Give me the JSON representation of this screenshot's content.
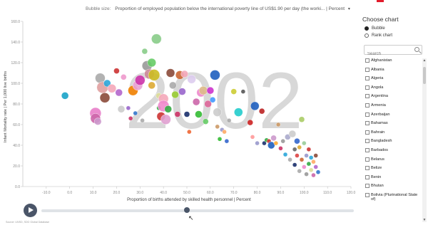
{
  "bubble_size": {
    "label": "Bubble size:",
    "value": "Proportion of employed population below the international poverty line of US$1.90 per day (the worki... | Percent",
    "caret": "▾"
  },
  "chart_data": {
    "type": "scatter",
    "year_watermark": "2002",
    "xlabel": "Proportion of births attended by skilled health personnel | Percent",
    "ylabel": "Infant Mortality rate | Per 1,000 live births",
    "xlim": [
      -20,
      120
    ],
    "ylim": [
      0,
      160
    ],
    "x_ticks": [
      "-10.0",
      "0.0",
      "10.0",
      "20.0",
      "30.0",
      "40.0",
      "50.0",
      "60.0",
      "70.0",
      "80.0",
      "90.0",
      "100.0",
      "110.0",
      "120.0"
    ],
    "y_ticks": [
      "160.0",
      "140.0",
      "120.0",
      "100.0",
      "80.0",
      "60.0",
      "40.0",
      "20.0",
      "0.0"
    ],
    "grid": false,
    "points": [
      {
        "x": -2,
        "y": 88,
        "r": 5,
        "color": "#1aa3c8"
      },
      {
        "x": 11,
        "y": 71,
        "r": 8,
        "color": "#e87ec9"
      },
      {
        "x": 11,
        "y": 66,
        "r": 7,
        "color": "#cc66aa"
      },
      {
        "x": 12,
        "y": 63,
        "r": 5,
        "color": "#cc99cc"
      },
      {
        "x": 13,
        "y": 105,
        "r": 7,
        "color": "#aaaaaa"
      },
      {
        "x": 14,
        "y": 96,
        "r": 8,
        "color": "#e0a0a0"
      },
      {
        "x": 15,
        "y": 86,
        "r": 7,
        "color": "#8b4a3a"
      },
      {
        "x": 16,
        "y": 100,
        "r": 5,
        "color": "#2aa6d9"
      },
      {
        "x": 18,
        "y": 95,
        "r": 6,
        "color": "#f4a7b9"
      },
      {
        "x": 20,
        "y": 112,
        "r": 4,
        "color": "#cc3333"
      },
      {
        "x": 21,
        "y": 91,
        "r": 5,
        "color": "#b366cc"
      },
      {
        "x": 22,
        "y": 75,
        "r": 5,
        "color": "#cccccc"
      },
      {
        "x": 23,
        "y": 106,
        "r": 4,
        "color": "#ee99cc"
      },
      {
        "x": 25,
        "y": 76,
        "r": 3,
        "color": "#9966cc"
      },
      {
        "x": 26,
        "y": 66,
        "r": 3,
        "color": "#cc3366"
      },
      {
        "x": 27,
        "y": 93,
        "r": 7,
        "color": "#f08000"
      },
      {
        "x": 28,
        "y": 71,
        "r": 3,
        "color": "#3377cc"
      },
      {
        "x": 29,
        "y": 98,
        "r": 7,
        "color": "#e9a3d6"
      },
      {
        "x": 30,
        "y": 103,
        "r": 7,
        "color": "#cc33aa"
      },
      {
        "x": 31,
        "y": 64,
        "r": 3,
        "color": "#aaaaaa"
      },
      {
        "x": 32,
        "y": 131,
        "r": 4,
        "color": "#88cc88"
      },
      {
        "x": 33,
        "y": 117,
        "r": 7,
        "color": "#999999"
      },
      {
        "x": 34,
        "y": 109,
        "r": 7,
        "color": "#cc8899"
      },
      {
        "x": 35,
        "y": 98,
        "r": 5,
        "color": "#ddaa33"
      },
      {
        "x": 35,
        "y": 120,
        "r": 6,
        "color": "#66cc66"
      },
      {
        "x": 36,
        "y": 108,
        "r": 8,
        "color": "#ccbb22"
      },
      {
        "x": 37,
        "y": 143,
        "r": 7,
        "color": "#88cc88"
      },
      {
        "x": 38,
        "y": 88,
        "r": 4,
        "color": "#dddd99"
      },
      {
        "x": 38,
        "y": 76,
        "r": 3,
        "color": "#33aa44"
      },
      {
        "x": 39,
        "y": 68,
        "r": 6,
        "color": "#cc3333"
      },
      {
        "x": 40,
        "y": 85,
        "r": 7,
        "color": "#f4a7b9"
      },
      {
        "x": 40,
        "y": 78,
        "r": 8,
        "color": "#ee88cc"
      },
      {
        "x": 41,
        "y": 65,
        "r": 7,
        "color": "#e0a0d0"
      },
      {
        "x": 42,
        "y": 75,
        "r": 5,
        "color": "#33aa44"
      },
      {
        "x": 43,
        "y": 110,
        "r": 6,
        "color": "#8b4a3a"
      },
      {
        "x": 44,
        "y": 98,
        "r": 5,
        "color": "#aaaaaa"
      },
      {
        "x": 45,
        "y": 89,
        "r": 5,
        "color": "#99cc33"
      },
      {
        "x": 46,
        "y": 70,
        "r": 4,
        "color": "#cc3366"
      },
      {
        "x": 47,
        "y": 108,
        "r": 6,
        "color": "#cc6633"
      },
      {
        "x": 48,
        "y": 92,
        "r": 5,
        "color": "#9966cc"
      },
      {
        "x": 49,
        "y": 109,
        "r": 5,
        "color": "#f4a7b9"
      },
      {
        "x": 50,
        "y": 70,
        "r": 4,
        "color": "#1a2f6b"
      },
      {
        "x": 51,
        "y": 53,
        "r": 3,
        "color": "#ee6633"
      },
      {
        "x": 52,
        "y": 104,
        "r": 6,
        "color": "#ddccee"
      },
      {
        "x": 54,
        "y": 82,
        "r": 5,
        "color": "#cc66aa"
      },
      {
        "x": 55,
        "y": 70,
        "r": 5,
        "color": "#33bb33"
      },
      {
        "x": 56,
        "y": 91,
        "r": 6,
        "color": "#ee88cc"
      },
      {
        "x": 57,
        "y": 93,
        "r": 6,
        "color": "#ddbb88"
      },
      {
        "x": 58,
        "y": 63,
        "r": 4,
        "color": "#66cc66"
      },
      {
        "x": 59,
        "y": 80,
        "r": 5,
        "color": "#dd6699"
      },
      {
        "x": 60,
        "y": 93,
        "r": 5,
        "color": "#cc33cc"
      },
      {
        "x": 61,
        "y": 84,
        "r": 4,
        "color": "#4499ff"
      },
      {
        "x": 62,
        "y": 108,
        "r": 7,
        "color": "#1f5fbf"
      },
      {
        "x": 63,
        "y": 72,
        "r": 6,
        "color": "#cccccc"
      },
      {
        "x": 63,
        "y": 58,
        "r": 3,
        "color": "#cc9966"
      },
      {
        "x": 64,
        "y": 46,
        "r": 3,
        "color": "#33bb33"
      },
      {
        "x": 65,
        "y": 55,
        "r": 3,
        "color": "#9999cc"
      },
      {
        "x": 66,
        "y": 53,
        "r": 3,
        "color": "#ffaa66"
      },
      {
        "x": 67,
        "y": 44,
        "r": 3,
        "color": "#3366cc"
      },
      {
        "x": 68,
        "y": 64,
        "r": 3,
        "color": "#aaaaaa"
      },
      {
        "x": 70,
        "y": 92,
        "r": 4,
        "color": "#cccc33"
      },
      {
        "x": 72,
        "y": 72,
        "r": 6,
        "color": "#22cccc"
      },
      {
        "x": 74,
        "y": 92,
        "r": 3,
        "color": "#555555"
      },
      {
        "x": 77,
        "y": 62,
        "r": 4,
        "color": "#cc2222"
      },
      {
        "x": 78,
        "y": 48,
        "r": 3,
        "color": "#ff9999"
      },
      {
        "x": 79,
        "y": 78,
        "r": 6,
        "color": "#1f5fbf"
      },
      {
        "x": 80,
        "y": 42,
        "r": 3,
        "color": "#9999cc"
      },
      {
        "x": 82,
        "y": 73,
        "r": 4,
        "color": "#bb2222"
      },
      {
        "x": 83,
        "y": 42,
        "r": 3,
        "color": "#1a2f6b"
      },
      {
        "x": 84,
        "y": 45,
        "r": 3,
        "color": "#33aa44"
      },
      {
        "x": 85,
        "y": 44,
        "r": 3,
        "color": "#cc3333"
      },
      {
        "x": 86,
        "y": 40,
        "r": 5,
        "color": "#1f5fbf"
      },
      {
        "x": 87,
        "y": 47,
        "r": 4,
        "color": "#cc99cc"
      },
      {
        "x": 88,
        "y": 42,
        "r": 3,
        "color": "#ffaa33"
      },
      {
        "x": 89,
        "y": 60,
        "r": 3,
        "color": "#cc9966"
      },
      {
        "x": 90,
        "y": 37,
        "r": 3,
        "color": "#cc3366"
      },
      {
        "x": 91,
        "y": 44,
        "r": 3,
        "color": "#999999"
      },
      {
        "x": 92,
        "y": 31,
        "r": 3,
        "color": "#2aa6d9"
      },
      {
        "x": 93,
        "y": 48,
        "r": 4,
        "color": "#aaaacc"
      },
      {
        "x": 94,
        "y": 26,
        "r": 3,
        "color": "#aaaaaa"
      },
      {
        "x": 95,
        "y": 51,
        "r": 5,
        "color": "#cccccc"
      },
      {
        "x": 96,
        "y": 36,
        "r": 3,
        "color": "#666666"
      },
      {
        "x": 96,
        "y": 21,
        "r": 3,
        "color": "#1a2f6b"
      },
      {
        "x": 97,
        "y": 44,
        "r": 4,
        "color": "#3366cc"
      },
      {
        "x": 97,
        "y": 30,
        "r": 3,
        "color": "#dd4444"
      },
      {
        "x": 98,
        "y": 38,
        "r": 3,
        "color": "#ddaa33"
      },
      {
        "x": 98,
        "y": 15,
        "r": 3,
        "color": "#aaaaaa"
      },
      {
        "x": 99,
        "y": 65,
        "r": 4,
        "color": "#aacc66"
      },
      {
        "x": 99,
        "y": 26,
        "r": 3,
        "color": "#cc6633"
      },
      {
        "x": 100,
        "y": 42,
        "r": 3,
        "color": "#99cc99"
      },
      {
        "x": 100,
        "y": 19,
        "r": 3,
        "color": "#ee88cc"
      },
      {
        "x": 101,
        "y": 30,
        "r": 3,
        "color": "#9999cc"
      },
      {
        "x": 101,
        "y": 12,
        "r": 3,
        "color": "#999999"
      },
      {
        "x": 102,
        "y": 36,
        "r": 3,
        "color": "#cc3333"
      },
      {
        "x": 102,
        "y": 22,
        "r": 3,
        "color": "#33aa44"
      },
      {
        "x": 103,
        "y": 28,
        "r": 3,
        "color": "#2aa6d9"
      },
      {
        "x": 103,
        "y": 16,
        "r": 3,
        "color": "#dddd99"
      },
      {
        "x": 104,
        "y": 24,
        "r": 3,
        "color": "#ffaa66"
      },
      {
        "x": 104,
        "y": 11,
        "r": 3,
        "color": "#cc66aa"
      },
      {
        "x": 105,
        "y": 19,
        "r": 3,
        "color": "#b366cc"
      },
      {
        "x": 105,
        "y": 30,
        "r": 3,
        "color": "#8b4a3a"
      },
      {
        "x": 106,
        "y": 14,
        "r": 3,
        "color": "#3377cc"
      }
    ]
  },
  "panel": {
    "title": "Choose chart",
    "options": [
      {
        "label": "Bubble",
        "selected": true
      },
      {
        "label": "Rank chart",
        "selected": false
      }
    ],
    "search_placeholder": "Search",
    "countries": [
      "Afghanistan",
      "Albania",
      "Algeria",
      "Angola",
      "Argentina",
      "Armenia",
      "Azerbaijan",
      "Bahamas",
      "Bahrain",
      "Bangladesh",
      "Barbados",
      "Belarus",
      "Belize",
      "Benin",
      "Bhutan",
      "Bolivia (Plurinational State of)"
    ]
  },
  "source_text": "Source: UNSD, SDG Global Database",
  "scroll_up": "▲",
  "scroll_down": "▼",
  "cursor_glyph": "↖"
}
